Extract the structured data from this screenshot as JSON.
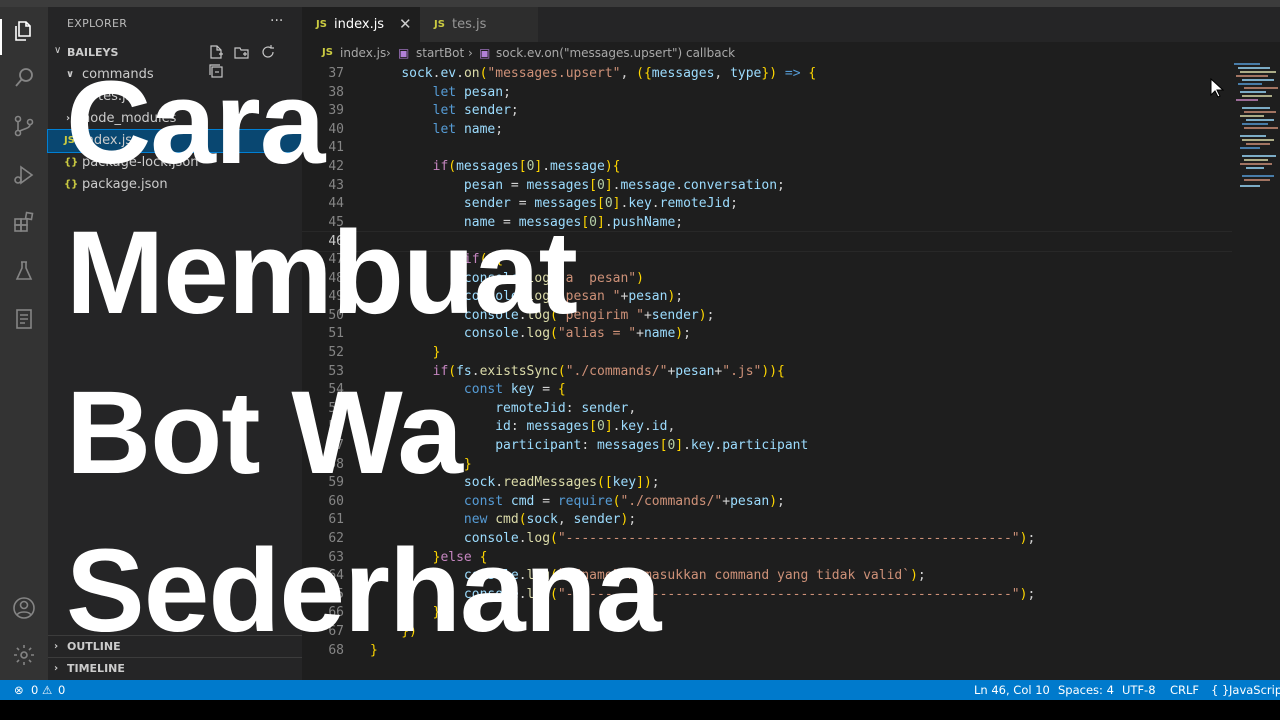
{
  "activity_bar": {
    "icons": [
      "files-icon",
      "search-icon",
      "source-control-icon",
      "run-debug-icon",
      "extensions-icon",
      "testing-icon",
      "notebook-icon",
      "account-icon",
      "settings-gear-icon"
    ]
  },
  "sidebar": {
    "title": "EXPLORER",
    "more": "···",
    "project": "BAILEYS",
    "tree": [
      {
        "label": "commands",
        "type": "folder",
        "indent": 1
      },
      {
        "label": "tes.js",
        "type": "js",
        "indent": 2
      },
      {
        "label": "node_modules",
        "type": "folder",
        "indent": 1
      },
      {
        "label": "index.js",
        "type": "js",
        "indent": 1,
        "selected": true
      },
      {
        "label": "package-lock.json",
        "type": "json",
        "indent": 1
      },
      {
        "label": "package.json",
        "type": "json",
        "indent": 1
      }
    ],
    "sections": [
      "OUTLINE",
      "TIMELINE"
    ]
  },
  "tabs": [
    {
      "label": "index.js",
      "active": true,
      "icon": "JS"
    },
    {
      "label": "tes.js",
      "active": false,
      "icon": "JS"
    }
  ],
  "breadcrumb": {
    "file": "index.js",
    "fn": "startBot",
    "callback": "sock.ev.on(\"messages.upsert\") callback"
  },
  "code": {
    "lines": [
      {
        "n": 37,
        "t": "    sock.ev.on(\"messages.upsert\", ({messages, type}) => {"
      },
      {
        "n": 38,
        "t": "        let pesan;"
      },
      {
        "n": 39,
        "t": "        let sender;"
      },
      {
        "n": 40,
        "t": "        let name;"
      },
      {
        "n": 41,
        "t": ""
      },
      {
        "n": 42,
        "t": "        if(messages[0].message){"
      },
      {
        "n": 43,
        "t": "            pesan = messages[0].message.conversation;"
      },
      {
        "n": 44,
        "t": "            sender = messages[0].key.remoteJid;"
      },
      {
        "n": 45,
        "t": "            name = messages[0].pushName;"
      },
      {
        "n": 46,
        "t": ""
      },
      {
        "n": 47,
        "t": "            if(){"
      },
      {
        "n": 48,
        "t": "            console.log(\"a  pesan\")"
      },
      {
        "n": 49,
        "t": "            console.log(\"pesan \"+pesan);"
      },
      {
        "n": 50,
        "t": "            console.log(\"pengirim \"+sender);"
      },
      {
        "n": 51,
        "t": "            console.log(\"alias = \"+name);"
      },
      {
        "n": 52,
        "t": "        }"
      },
      {
        "n": 53,
        "t": "        if(fs.existsSync(\"./commands/\"+pesan+\".js\")){"
      },
      {
        "n": 54,
        "t": "            const key = {"
      },
      {
        "n": 55,
        "t": "                remoteJid: sender,"
      },
      {
        "n": 56,
        "t": "                id: messages[0].key.id,"
      },
      {
        "n": 57,
        "t": "                participant: messages[0].key.participant"
      },
      {
        "n": 58,
        "t": "            }"
      },
      {
        "n": 59,
        "t": "            sock.readMessages([key]);"
      },
      {
        "n": 60,
        "t": "            const cmd = require(\"./commands/\"+pesan);"
      },
      {
        "n": 61,
        "t": "            new cmd(sock, sender);"
      },
      {
        "n": 62,
        "t": "            console.log(\"---------------------------------------------------------\");"
      },
      {
        "n": 63,
        "t": "        }else {"
      },
      {
        "n": 64,
        "t": "            console.log(`${name} memasukkan command yang tidak valid`);"
      },
      {
        "n": 65,
        "t": "            console.log(\"---------------------------------------------------------\");"
      },
      {
        "n": 66,
        "t": "        }"
      },
      {
        "n": 67,
        "t": "    })"
      },
      {
        "n": 68,
        "t": "}"
      }
    ],
    "current_line": 46
  },
  "overlay_title": [
    "Cara",
    "Membuat",
    "Bot Wa",
    "Sederhana"
  ],
  "status_bar": {
    "errors": "0",
    "warnings": "0",
    "position": "Ln 46, Col 10",
    "spaces": "Spaces: 4",
    "encoding": "UTF-8",
    "eol": "CRLF",
    "language": "JavaScript",
    "language_icon": "{ }"
  },
  "colors": {
    "status_bar": "#007acc",
    "editor_bg": "#1e1e1e",
    "sidebar_bg": "#252526",
    "activity_bg": "#333333",
    "selection": "#094771",
    "keyword": "#569cd6",
    "string": "#ce9178",
    "function": "#dcdcaa",
    "variable": "#9cdcfe",
    "control": "#c586c0",
    "number": "#b5cea8"
  }
}
